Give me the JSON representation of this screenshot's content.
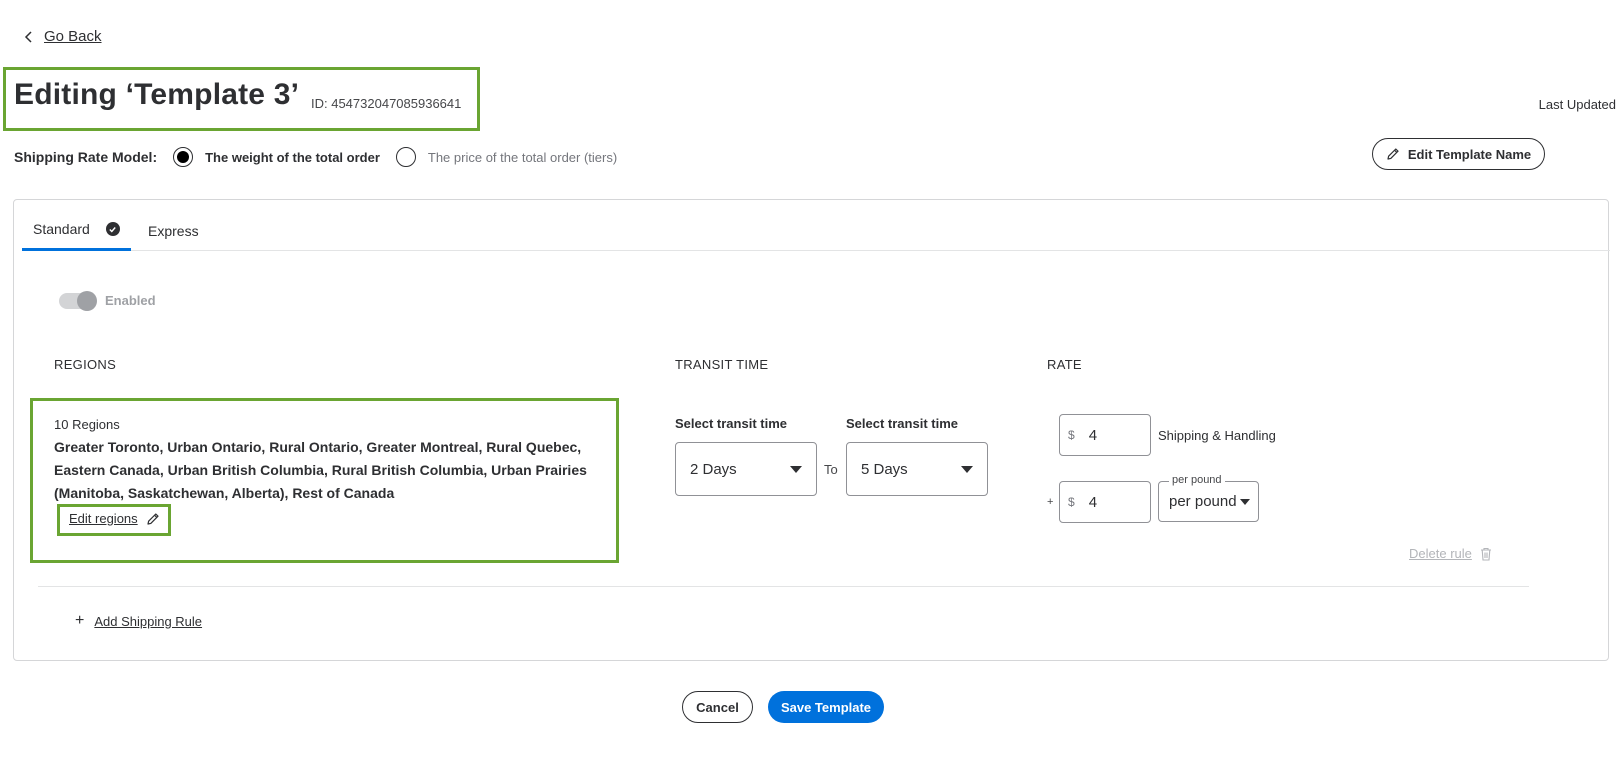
{
  "nav": {
    "go_back_label": "Go Back"
  },
  "header": {
    "title": "Editing ‘Template 3’",
    "template_id": "ID: 454732047085936641",
    "last_updated_label": "Last Updated",
    "edit_name_label": "Edit Template Name"
  },
  "rate_model": {
    "label": "Shipping Rate Model:",
    "options": [
      {
        "label": "The weight of the total order",
        "selected": true
      },
      {
        "label": "The price of the total order (tiers)",
        "selected": false
      }
    ]
  },
  "tabs": [
    {
      "label": "Standard",
      "active": true
    },
    {
      "label": "Express",
      "active": false
    }
  ],
  "rule": {
    "enabled_label": "Enabled",
    "enabled": true,
    "columns": {
      "regions": "REGIONS",
      "transit": "TRANSIT TIME",
      "rate": "RATE"
    },
    "regions": {
      "count": "10 Regions",
      "list": "Greater Toronto, Urban Ontario, Rural Ontario, Greater Montreal, Rural Quebec, Eastern Canada, Urban British Columbia, Rural British Columbia, Urban Prairies (Manitoba, Saskatchewan, Alberta), Rest of Canada",
      "edit_label": "Edit regions"
    },
    "transit": {
      "from_label": "Select transit time",
      "from_value": "2 Days",
      "to_word": "To",
      "to_label": "Select transit time",
      "to_value": "5 Days"
    },
    "rate": {
      "currency": "$",
      "base_value": "4",
      "base_label": "Shipping & Handling",
      "plus": "+",
      "per_value": "4",
      "unit_legend": "per pound",
      "unit_value": "per pound"
    },
    "delete_label": "Delete rule"
  },
  "add_rule_label": "Add Shipping Rule",
  "footer": {
    "cancel_label": "Cancel",
    "save_label": "Save Template"
  },
  "colors": {
    "accent": "#0071dc",
    "highlight": "#6aa532",
    "text": "#2e2f32"
  }
}
